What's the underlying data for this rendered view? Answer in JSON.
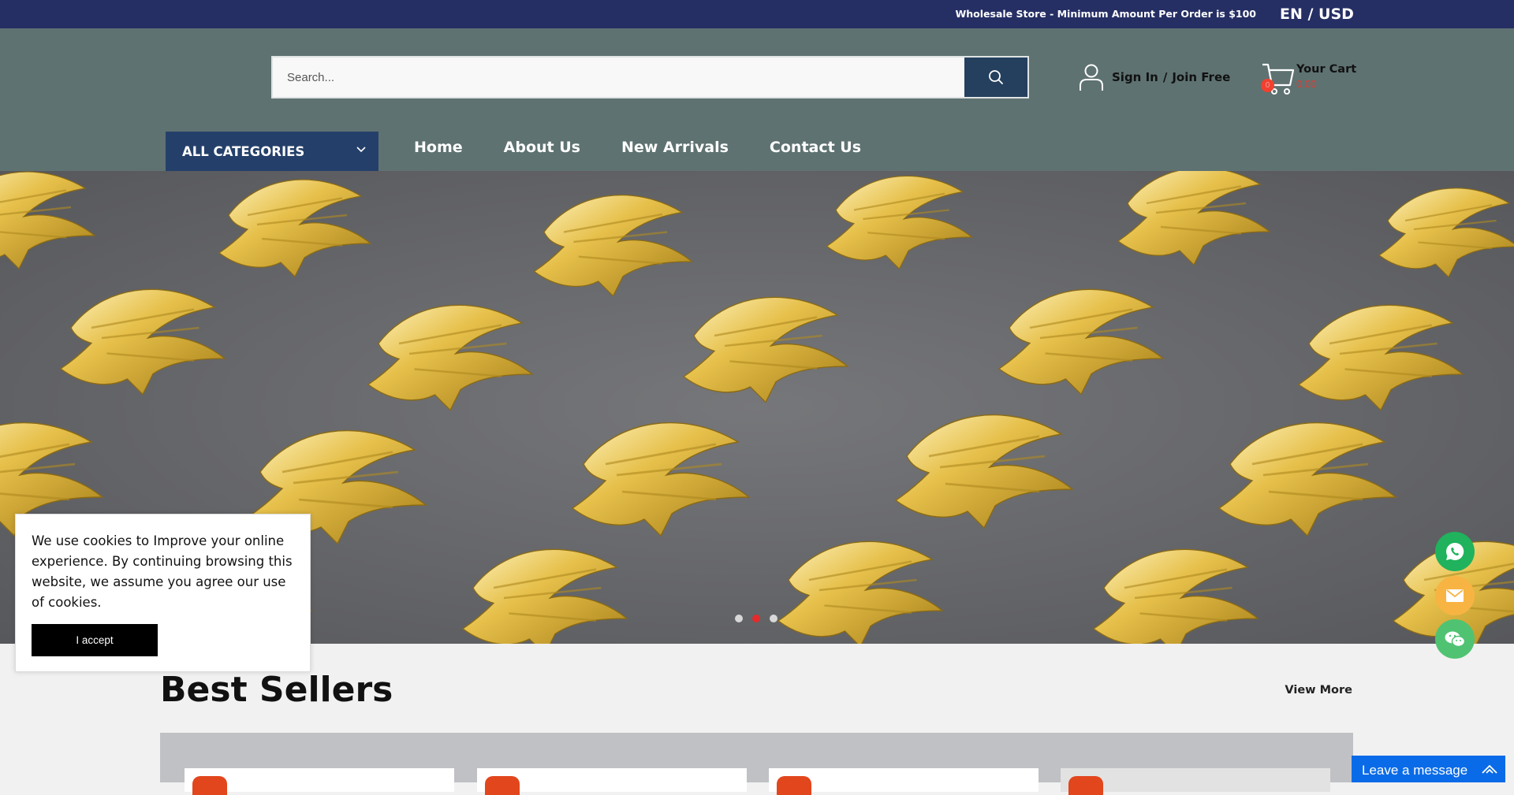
{
  "topbar": {
    "notice": "Wholesale Store - Minimum Amount Per Order is $100",
    "locale": "EN / USD"
  },
  "search": {
    "placeholder": "Search...",
    "value": ""
  },
  "account": {
    "sign_in": "Sign In",
    "separator": "/",
    "join": "Join Free"
  },
  "cart": {
    "label": "Your Cart",
    "count": "0",
    "amount": "0.00"
  },
  "categories": {
    "label": "ALL CATEGORIES"
  },
  "nav": {
    "items": [
      "Home",
      "About Us",
      "New Arrivals",
      "Contact Us"
    ]
  },
  "hero": {
    "slides": 3,
    "active_slide": 2
  },
  "best_sellers": {
    "title": "Best Sellers",
    "view_more": "View More"
  },
  "cookie": {
    "text": "We use cookies to Improve your online experience. By continuing browsing this website, we assume you agree our use of cookies.",
    "accept": "I accept"
  },
  "chat": {
    "leave_message": "Leave a message"
  },
  "colors": {
    "topbar": "#252f64",
    "header": "#5f7272",
    "categories": "#24406a",
    "search_button": "#25405e",
    "accent_red": "#e53c30",
    "whatsapp": "#20b25c",
    "email": "#f7b443",
    "wechat": "#4fc372",
    "chat": "#0a6be8"
  },
  "icons": [
    "search-icon",
    "user-icon",
    "cart-icon",
    "chevron-down-icon",
    "whatsapp-icon",
    "email-icon",
    "wechat-icon",
    "chevron-up-icon"
  ]
}
